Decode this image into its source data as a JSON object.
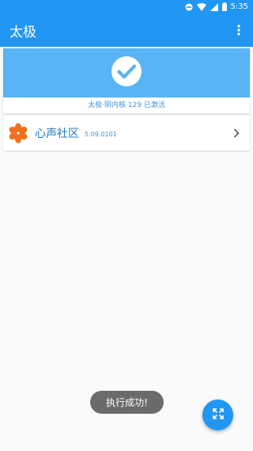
{
  "status_bar": {
    "time": "5:35"
  },
  "app_bar": {
    "title": "太极",
    "menu_icon": "more-vert-icon"
  },
  "framework_status": {
    "icon": "check-circle-icon",
    "text": "太极·阴内核 129 已激活",
    "banner_color": "#5ab3f5"
  },
  "modules": [
    {
      "name": "心声社区",
      "version": "5.09.0101",
      "icon": "flower-logo-icon"
    }
  ],
  "toast": {
    "text": "执行成功!"
  },
  "fab": {
    "icon": "expand-icon"
  },
  "colors": {
    "primary": "#2196f3",
    "accent_text": "#3f93d8",
    "logo": "#f0701c"
  }
}
